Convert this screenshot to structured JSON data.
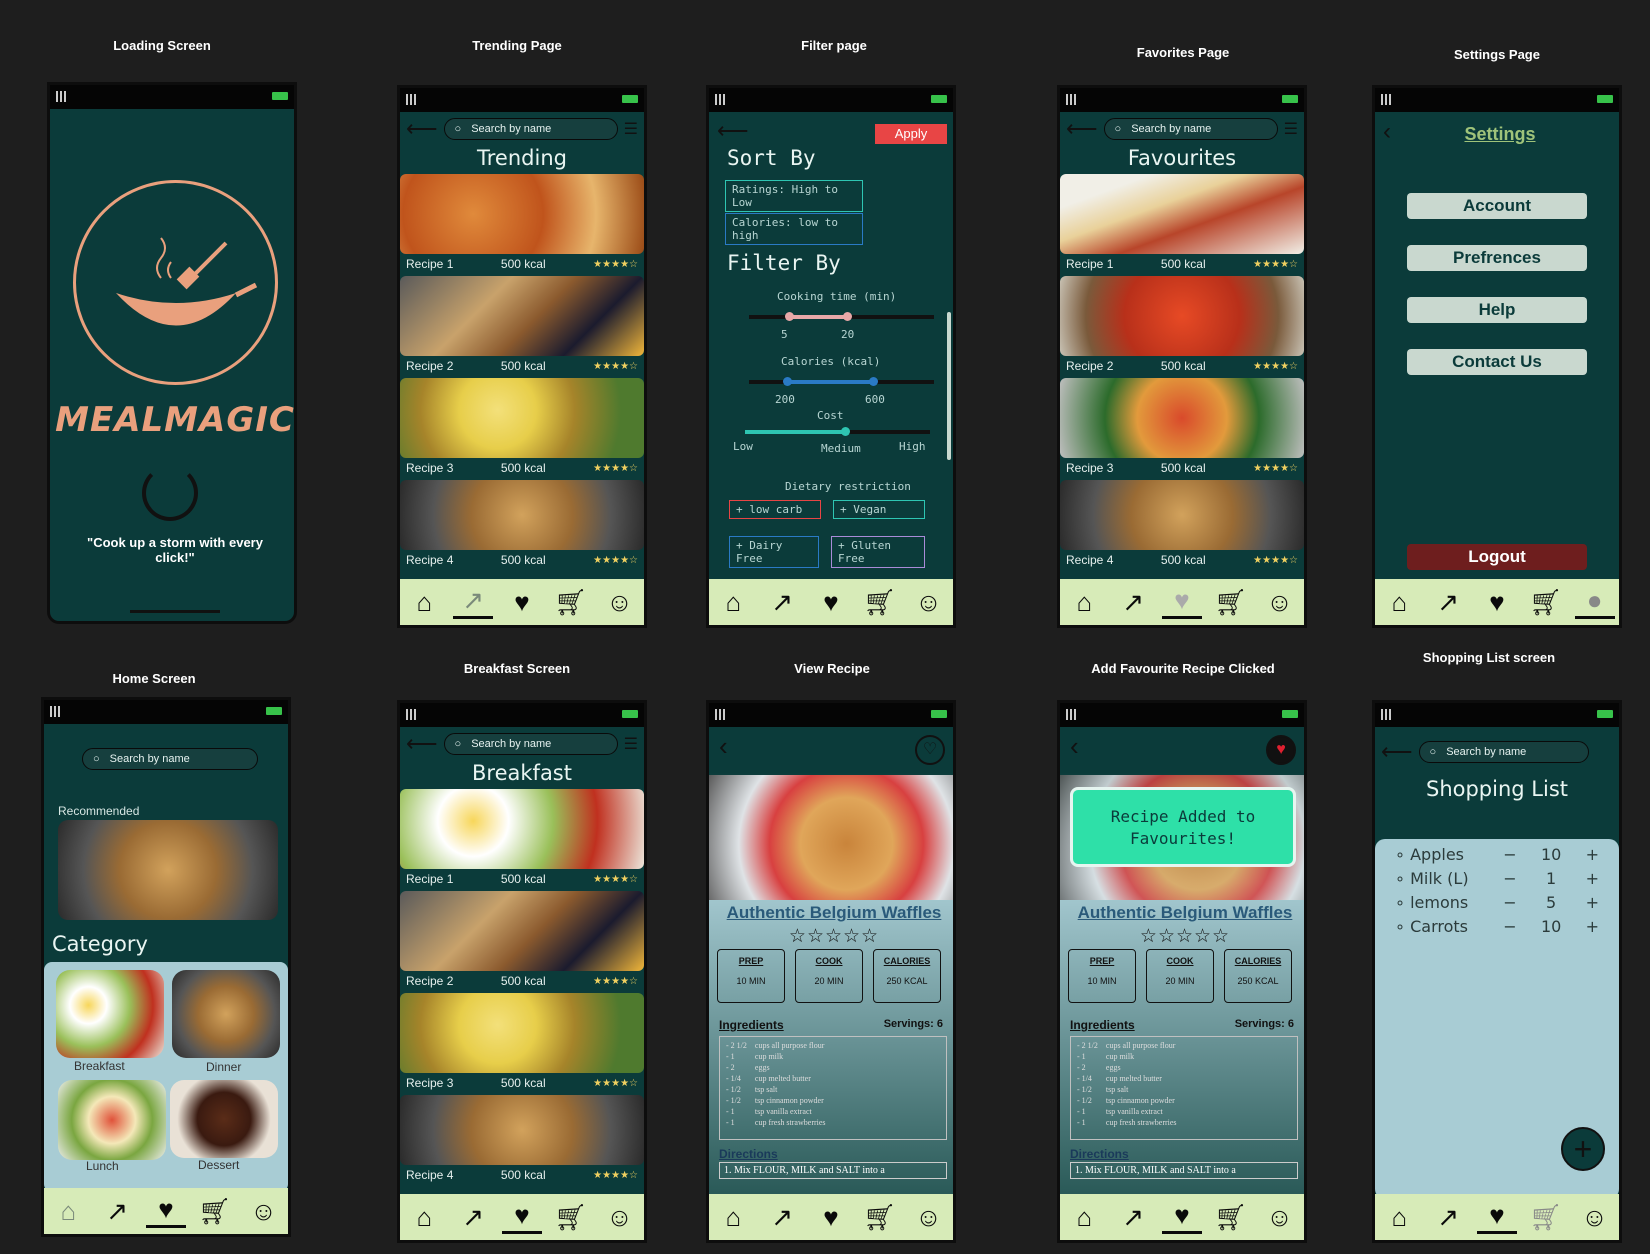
{
  "frames": {
    "loading": "Loading Screen",
    "trending": "Trending Page",
    "filter": "Filter page",
    "favorites": "Favorites Page",
    "settings": "Settings Page",
    "home": "Home Screen",
    "breakfast": "Breakfast Screen",
    "view": "View Recipe",
    "addfav": "Add Favourite Recipe Clicked",
    "shopping": "Shopping List screen"
  },
  "search_placeholder": "Search by name",
  "loading": {
    "brand": "MEALMAGIC",
    "quote": "\"Cook up a storm with every click!\""
  },
  "trending": {
    "title": "Trending",
    "recipes": [
      {
        "name": "Recipe 1",
        "kcal": "500 kcal"
      },
      {
        "name": "Recipe 2",
        "kcal": "500 kcal"
      },
      {
        "name": "Recipe 3",
        "kcal": "500 kcal"
      },
      {
        "name": "Recipe 4",
        "kcal": "500 kcal"
      }
    ]
  },
  "stars": "★★★★☆",
  "filter": {
    "apply": "Apply",
    "sort_by": "Sort By",
    "sort1": "Ratings: High to Low",
    "sort2": "Calories: low to high",
    "filter_by": "Filter By",
    "cooking": "Cooking time (min)",
    "cook_min": "5",
    "cook_max": "20",
    "calories": "Calories (kcal)",
    "cal_min": "200",
    "cal_max": "600",
    "cost": "Cost",
    "low": "Low",
    "medium": "Medium",
    "high": "High",
    "dietary": "Dietary restriction",
    "tags": [
      "+ low carb",
      "+ Vegan",
      "+ Dairy Free",
      "+ Gluten Free"
    ]
  },
  "favorites": {
    "title": "Favourites"
  },
  "settings": {
    "title": "Settings",
    "items": [
      "Account",
      "Prefrences",
      "Help",
      "Contact Us"
    ],
    "logout": "Logout"
  },
  "home": {
    "recommended": "Recommended",
    "category": "Category",
    "cats": [
      "Breakfast",
      "Dinner",
      "Lunch",
      "Dessert"
    ]
  },
  "breakfast": {
    "title": "Breakfast"
  },
  "view": {
    "title": "Authentic Belgium Waffles",
    "rating": "☆☆☆☆☆",
    "prep_l": "PREP",
    "prep": "10 MIN",
    "cook_l": "COOK",
    "cook": "20 MIN",
    "cal_l": "CALORIES",
    "cal": "250 KCAL",
    "ingredients": "Ingredients",
    "servings": "Servings: 6",
    "ing_qty": [
      "- 2 1/2",
      "- 1",
      "- 2",
      "- 1/4",
      "- 1/2",
      "- 1/2",
      "- 1",
      "- 1"
    ],
    "ing_item": [
      "cups all purpose flour",
      "cup milk",
      "eggs",
      "cup melted butter",
      "tsp salt",
      "tsp cinnamon powder",
      "tsp vanilla extract",
      "cup fresh strawberries"
    ],
    "directions": "Directions",
    "step1": "1. Mix FLOUR, MILK and SALT into a"
  },
  "addfav": {
    "toast": "Recipe Added to Favourites!"
  },
  "shopping": {
    "title": "Shopping List",
    "items": [
      {
        "name": "Apples",
        "qty": "10"
      },
      {
        "name": "Milk (L)",
        "qty": "1"
      },
      {
        "name": "lemons",
        "qty": "5"
      },
      {
        "name": "Carrots",
        "qty": "10"
      }
    ]
  },
  "colors": {
    "accent": "#e9a07d",
    "bg": "#0b3b3a",
    "nav": "#d7ebb8",
    "apply": "#e84545",
    "logout": "#6e1e1e",
    "toast": "#2ee0a8"
  }
}
